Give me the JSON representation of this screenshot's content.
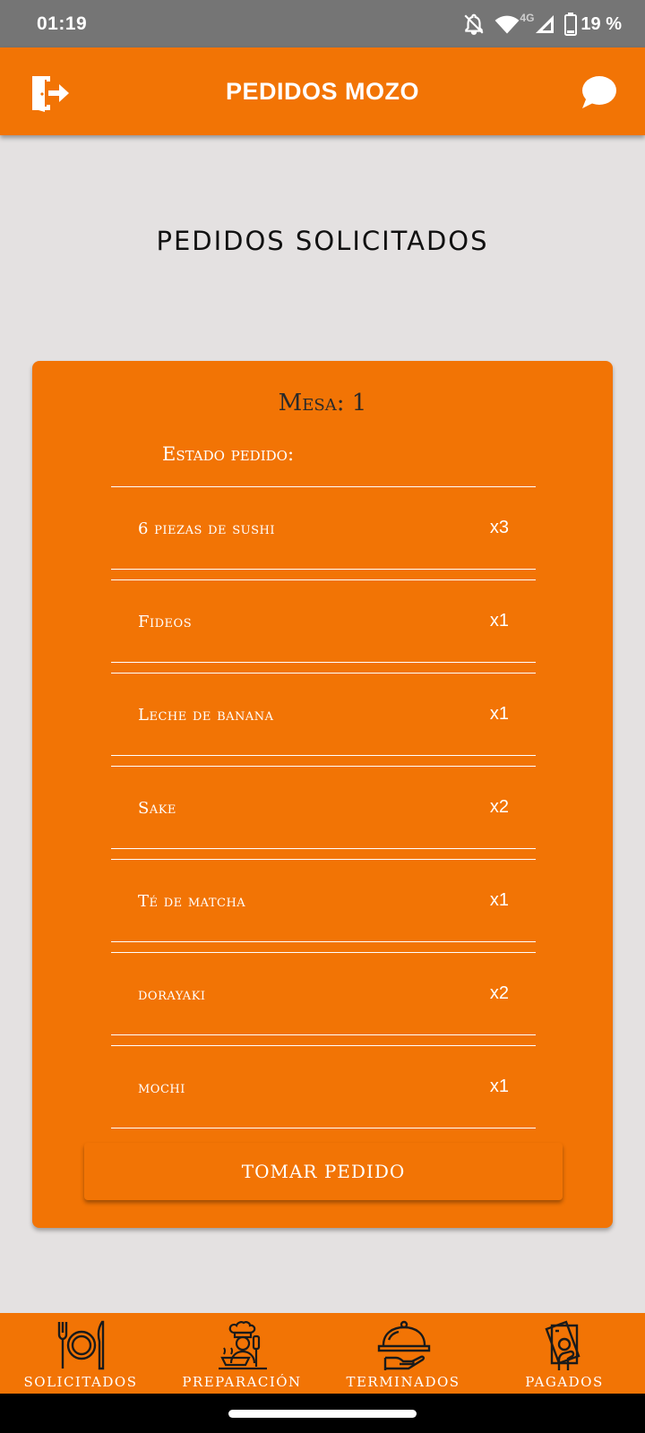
{
  "status_bar": {
    "time": "01:19",
    "network": "4G",
    "battery": "19 %"
  },
  "app_bar": {
    "title": "PEDIDOS MOZO",
    "left_icon": "logout-icon",
    "right_icon": "chat-icon"
  },
  "page": {
    "title": "PEDIDOS SOLICITADOS"
  },
  "order": {
    "mesa": "Mesa: 1",
    "estado": "Estado pedido:",
    "items": [
      {
        "name": "6 piezas de sushi",
        "qty": "x3"
      },
      {
        "name": "Fideos",
        "qty": "x1"
      },
      {
        "name": "Leche de banana",
        "qty": "x1"
      },
      {
        "name": "Sake",
        "qty": "x2"
      },
      {
        "name": "Té de matcha",
        "qty": "x1"
      },
      {
        "name": "dorayaki",
        "qty": "x2"
      },
      {
        "name": "mochi",
        "qty": "x1"
      }
    ],
    "action_label": "TOMAR PEDIDO"
  },
  "bottom_nav": [
    {
      "label": "SOLICITADOS",
      "icon": "dish-cutlery-icon"
    },
    {
      "label": "PREPARACIÓN",
      "icon": "chef-icon"
    },
    {
      "label": "TERMINADOS",
      "icon": "serving-cloche-icon"
    },
    {
      "label": "PAGADOS",
      "icon": "money-icon"
    }
  ],
  "colors": {
    "primary": "#f27405",
    "background": "#e4e1e1",
    "status_bar": "#757575"
  }
}
